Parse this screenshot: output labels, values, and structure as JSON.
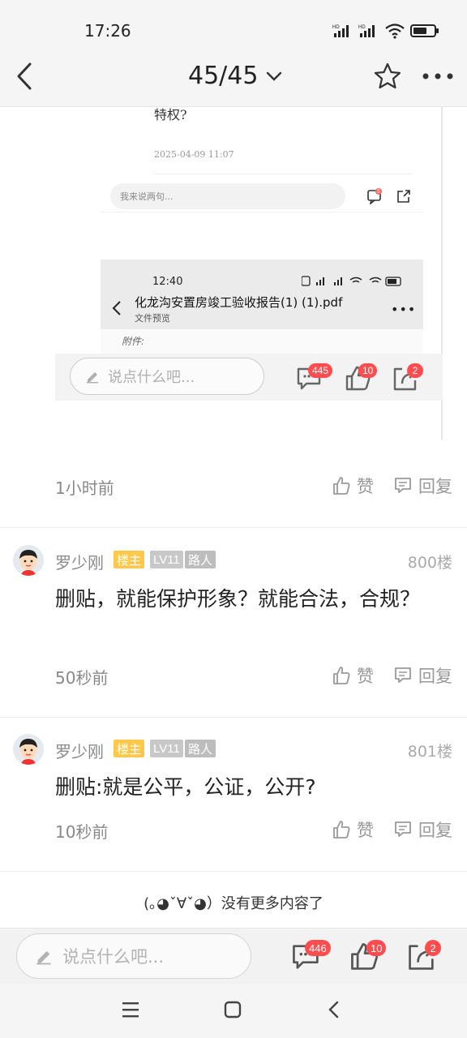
{
  "status_bar": {
    "time": "17:26",
    "network": "HD",
    "icons": [
      "signal-icon",
      "signal-icon",
      "wifi-icon",
      "battery-icon"
    ]
  },
  "header": {
    "page_indicator": "45/45"
  },
  "embedded_screenshot": {
    "text": "特权?",
    "date": "2025-04-09 11:07",
    "input_placeholder": "我来说两句...",
    "comment_badge": "5",
    "phone_time": "12:40",
    "file_title": "化龙沟安置房竣工验收报告(1) (1).pdf",
    "file_subtitle": "文件预览",
    "handwriting": "附件:",
    "bottom_placeholder": "说点什么吧...",
    "counts": {
      "comments": "445",
      "likes": "10",
      "shares": "2"
    }
  },
  "post": {
    "time": "1小时前",
    "like_label": "赞",
    "reply_label": "回复"
  },
  "comments": [
    {
      "user": "罗少刚",
      "tag_host": "楼主",
      "tag_level": "LV11",
      "tag_role": "路人",
      "floor": "800楼",
      "text": "删贴，就能保护形象？就能合法，合规？",
      "time": "50秒前",
      "like_label": "赞",
      "reply_label": "回复"
    },
    {
      "user": "罗少刚",
      "tag_host": "楼主",
      "tag_level": "LV11",
      "tag_role": "路人",
      "floor": "801楼",
      "text": "删贴:就是公平，公证，公开?",
      "time": "10秒前",
      "like_label": "赞",
      "reply_label": "回复"
    }
  ],
  "end_text": "(｡◕ˇ∀ˇ◕）没有更多内容了",
  "bottom_bar": {
    "placeholder": "说点什么吧...",
    "counts": {
      "comments": "446",
      "likes": "10",
      "shares": "2"
    }
  },
  "colors": {
    "badge": "#ff4d4f",
    "tag_host": "#ffc84a",
    "tag_level": "#c8c8c8"
  }
}
